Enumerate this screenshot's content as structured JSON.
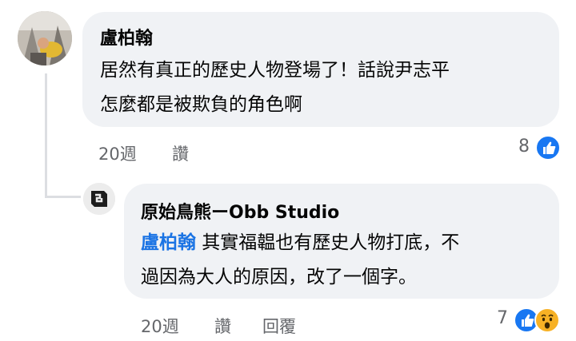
{
  "comment": {
    "author": "盧柏翰",
    "lines": [
      "居然有真正的歷史人物登場了！話說尹志平",
      "怎麼都是被欺負的角色啊"
    ],
    "time": "20週",
    "like_label": "讚",
    "reaction_count": "8",
    "reactions": [
      "like-icon"
    ]
  },
  "reply": {
    "author": "原始鳥熊ーObb Studio",
    "mention": "盧柏翰",
    "line1_rest": " 其實福韞也有歷史人物打底，不",
    "line2": "過因為大人的原因，改了一個字。",
    "time": "20週",
    "like_label": "讚",
    "reply_label": "回覆",
    "reaction_count": "7",
    "reactions": [
      "like-icon",
      "wow-icon"
    ]
  },
  "colors": {
    "bubble": "#f0f2f5",
    "mention": "#1b74e4",
    "like_blue": "#1877f2",
    "wow_yellow": "#f7b125"
  }
}
